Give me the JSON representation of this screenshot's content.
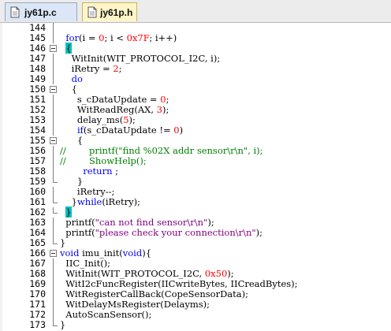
{
  "tabs": [
    {
      "label": "jy61p.c",
      "active": true
    },
    {
      "label": "jy61p.h",
      "active": false
    }
  ],
  "lines": [
    {
      "n": "144",
      "fold": "line",
      "code": ""
    },
    {
      "n": "145",
      "fold": "line",
      "code": "  for(i = 0; i < 0x7F; i++)"
    },
    {
      "n": "146",
      "fold": "box",
      "code": "  {"
    },
    {
      "n": "147",
      "fold": "line",
      "code": "    WitInit(WIT_PROTOCOL_I2C, i);"
    },
    {
      "n": "148",
      "fold": "line",
      "code": "    iRetry = 2;"
    },
    {
      "n": "149",
      "fold": "line",
      "code": "    do"
    },
    {
      "n": "150",
      "fold": "box",
      "code": "    {"
    },
    {
      "n": "151",
      "fold": "line",
      "code": "      s_cDataUpdate = 0;"
    },
    {
      "n": "152",
      "fold": "line",
      "code": "      WitReadReg(AX, 3);"
    },
    {
      "n": "153",
      "fold": "line",
      "code": "      delay_ms(5);"
    },
    {
      "n": "154",
      "fold": "line",
      "code": "      if(s_cDataUpdate != 0)"
    },
    {
      "n": "155",
      "fold": "box",
      "code": "      {"
    },
    {
      "n": "156",
      "fold": "line",
      "code": "//        printf(\"find %02X addr sensor\\r\\n\", i);"
    },
    {
      "n": "157",
      "fold": "line",
      "code": "//        ShowHelp();"
    },
    {
      "n": "158",
      "fold": "line",
      "code": "        return ;"
    },
    {
      "n": "159",
      "fold": "end",
      "code": "      }"
    },
    {
      "n": "160",
      "fold": "line",
      "code": "      iRetry--;"
    },
    {
      "n": "161",
      "fold": "end",
      "code": "    }while(iRetry);"
    },
    {
      "n": "162",
      "fold": "end",
      "code": "  }"
    },
    {
      "n": "163",
      "fold": "line",
      "code": "  printf(\"can not find sensor\\r\\n\");"
    },
    {
      "n": "164",
      "fold": "line",
      "code": "  printf(\"please check your connection\\r\\n\");"
    },
    {
      "n": "165",
      "fold": "end",
      "code": "}"
    },
    {
      "n": "166",
      "fold": "box",
      "code": "void imu_init(void){"
    },
    {
      "n": "167",
      "fold": "line",
      "code": "  IIC_Init();"
    },
    {
      "n": "168",
      "fold": "line",
      "code": "  WitInit(WIT_PROTOCOL_I2C, 0x50);"
    },
    {
      "n": "169",
      "fold": "line",
      "code": "  WitI2cFuncRegister(IICwriteBytes, IICreadBytes);"
    },
    {
      "n": "170",
      "fold": "line",
      "code": "  WitRegisterCallBack(CopeSensorData);"
    },
    {
      "n": "171",
      "fold": "line",
      "code": "  WitDelayMsRegister(Delayms);"
    },
    {
      "n": "172",
      "fold": "line",
      "code": "  AutoScanSensor();"
    },
    {
      "n": "173",
      "fold": "end",
      "code": "}"
    }
  ],
  "colors": {
    "keyword": "#0000ff",
    "number": "#ff0000",
    "comment": "#008000",
    "string": "#800080",
    "brace_highlight": "#00c0c0",
    "active_tab": "#dbe7f6",
    "inactive_tab": "#fff6c8"
  },
  "icons": {
    "c_file": "document-icon",
    "h_file": "document-icon"
  }
}
